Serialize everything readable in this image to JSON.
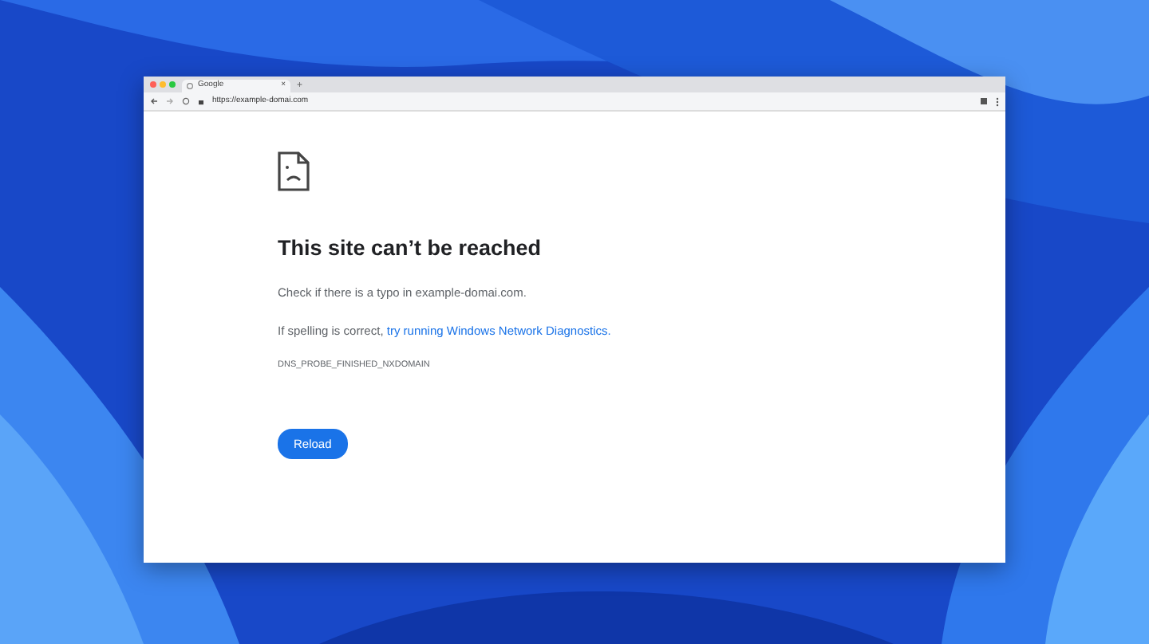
{
  "browser": {
    "tab": {
      "title": "Google",
      "close": "×"
    },
    "new_tab": "+",
    "url": "https://example-domai.com"
  },
  "error_page": {
    "heading": "This site can’t be reached",
    "check": "Check if there is a typo in example-domai.com.",
    "spelling_prefix": "If spelling is correct,",
    "spelling_link": "try running Windows Network Diagnostics.",
    "code": "DNS_PROBE_FINISHED_NXDOMAIN",
    "button": "Reload"
  }
}
